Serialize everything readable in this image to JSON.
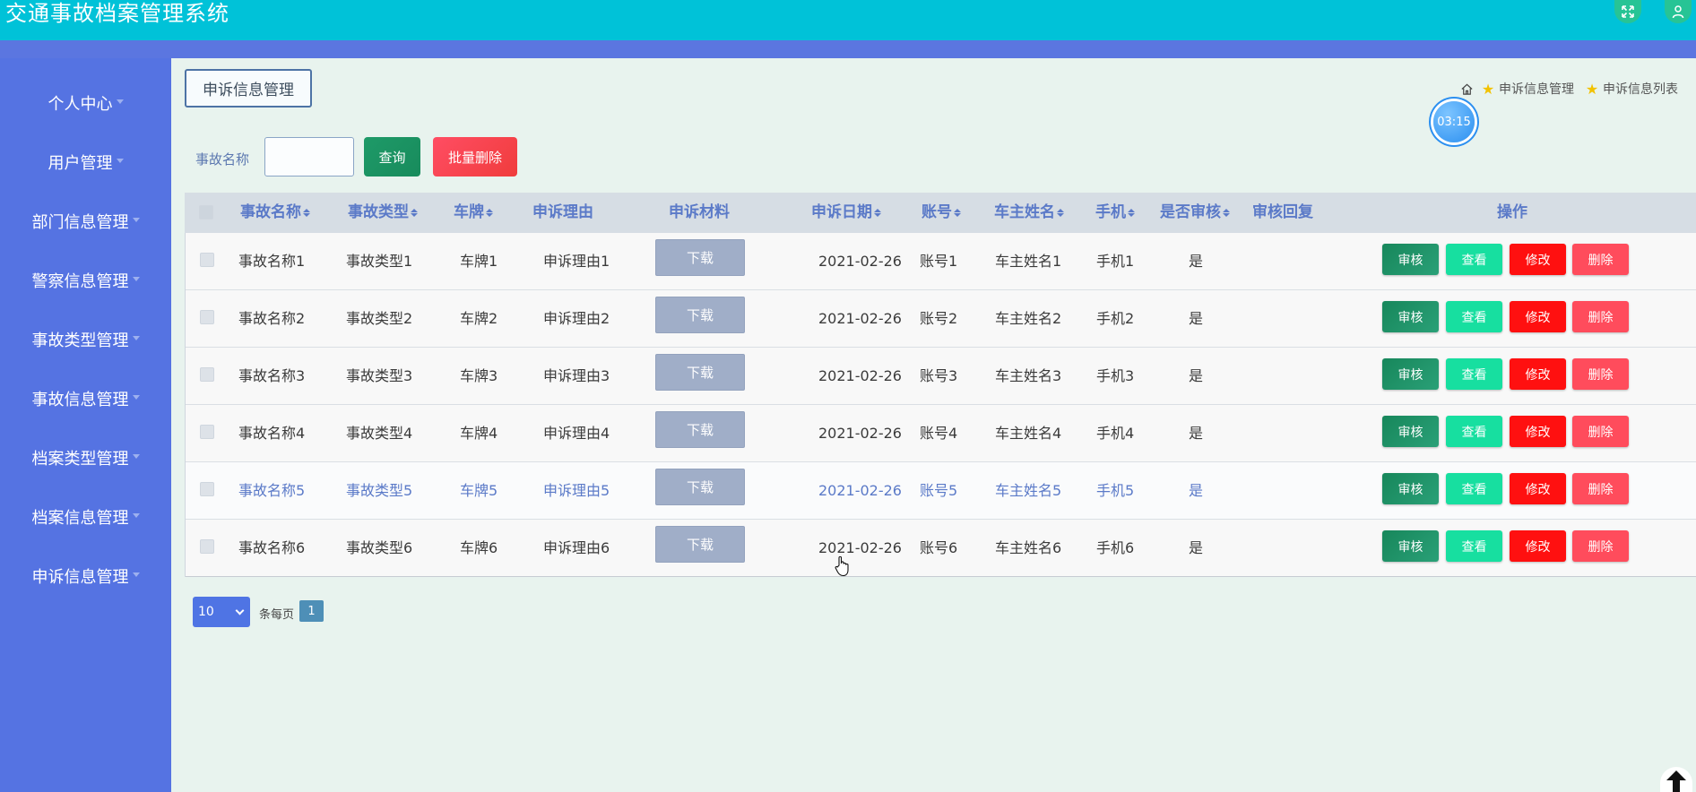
{
  "app": {
    "title": "交通事故档案管理系统"
  },
  "header_icons": {
    "expand": "expand-icon",
    "user": "user-icon"
  },
  "sidebar": {
    "items": [
      {
        "label": "个人中心"
      },
      {
        "label": "用户管理"
      },
      {
        "label": "部门信息管理"
      },
      {
        "label": "警察信息管理"
      },
      {
        "label": "事故类型管理"
      },
      {
        "label": "事故信息管理"
      },
      {
        "label": "档案类型管理"
      },
      {
        "label": "档案信息管理"
      },
      {
        "label": "申诉信息管理"
      }
    ]
  },
  "page": {
    "tab_label": "申诉信息管理",
    "breadcrumb": [
      "申诉信息管理",
      "申诉信息列表"
    ],
    "timer": "03:15"
  },
  "search": {
    "label": "事故名称",
    "value": "",
    "placeholder": "",
    "query_label": "查询",
    "batch_delete_label": "批量删除"
  },
  "table": {
    "headers": {
      "name": "事故名称",
      "type": "事故类型",
      "plate": "车牌",
      "reason": "申诉理由",
      "material": "申诉材料",
      "date": "申诉日期",
      "account": "账号",
      "owner": "车主姓名",
      "phone": "手机",
      "audited": "是否审核",
      "reply": "审核回复",
      "ops": "操作"
    },
    "download_label": "下载",
    "op_labels": {
      "audit": "审核",
      "view": "查看",
      "edit": "修改",
      "delete": "删除"
    },
    "rows": [
      {
        "name": "事故名称1",
        "type": "事故类型1",
        "plate": "车牌1",
        "reason": "申诉理由1",
        "date": "2021-02-26",
        "account": "账号1",
        "owner": "车主姓名1",
        "phone": "手机1",
        "audited": "是",
        "reply": ""
      },
      {
        "name": "事故名称2",
        "type": "事故类型2",
        "plate": "车牌2",
        "reason": "申诉理由2",
        "date": "2021-02-26",
        "account": "账号2",
        "owner": "车主姓名2",
        "phone": "手机2",
        "audited": "是",
        "reply": ""
      },
      {
        "name": "事故名称3",
        "type": "事故类型3",
        "plate": "车牌3",
        "reason": "申诉理由3",
        "date": "2021-02-26",
        "account": "账号3",
        "owner": "车主姓名3",
        "phone": "手机3",
        "audited": "是",
        "reply": ""
      },
      {
        "name": "事故名称4",
        "type": "事故类型4",
        "plate": "车牌4",
        "reason": "申诉理由4",
        "date": "2021-02-26",
        "account": "账号4",
        "owner": "车主姓名4",
        "phone": "手机4",
        "audited": "是",
        "reply": ""
      },
      {
        "name": "事故名称5",
        "type": "事故类型5",
        "plate": "车牌5",
        "reason": "申诉理由5",
        "date": "2021-02-26",
        "account": "账号5",
        "owner": "车主姓名5",
        "phone": "手机5",
        "audited": "是",
        "reply": ""
      },
      {
        "name": "事故名称6",
        "type": "事故类型6",
        "plate": "车牌6",
        "reason": "申诉理由6",
        "date": "2021-02-26",
        "account": "账号6",
        "owner": "车主姓名6",
        "phone": "手机6",
        "audited": "是",
        "reply": ""
      }
    ]
  },
  "pagination": {
    "page_size": "10",
    "per_page_label": "条每页",
    "current_page": "1"
  },
  "colors": {
    "header": "#00c2d8",
    "sidebar": "#5573e2",
    "accent_text": "#5b7ac8",
    "audit": "#17875b",
    "view": "#17dfa0",
    "edit": "#ff1010",
    "delete": "#ff4c5c"
  }
}
